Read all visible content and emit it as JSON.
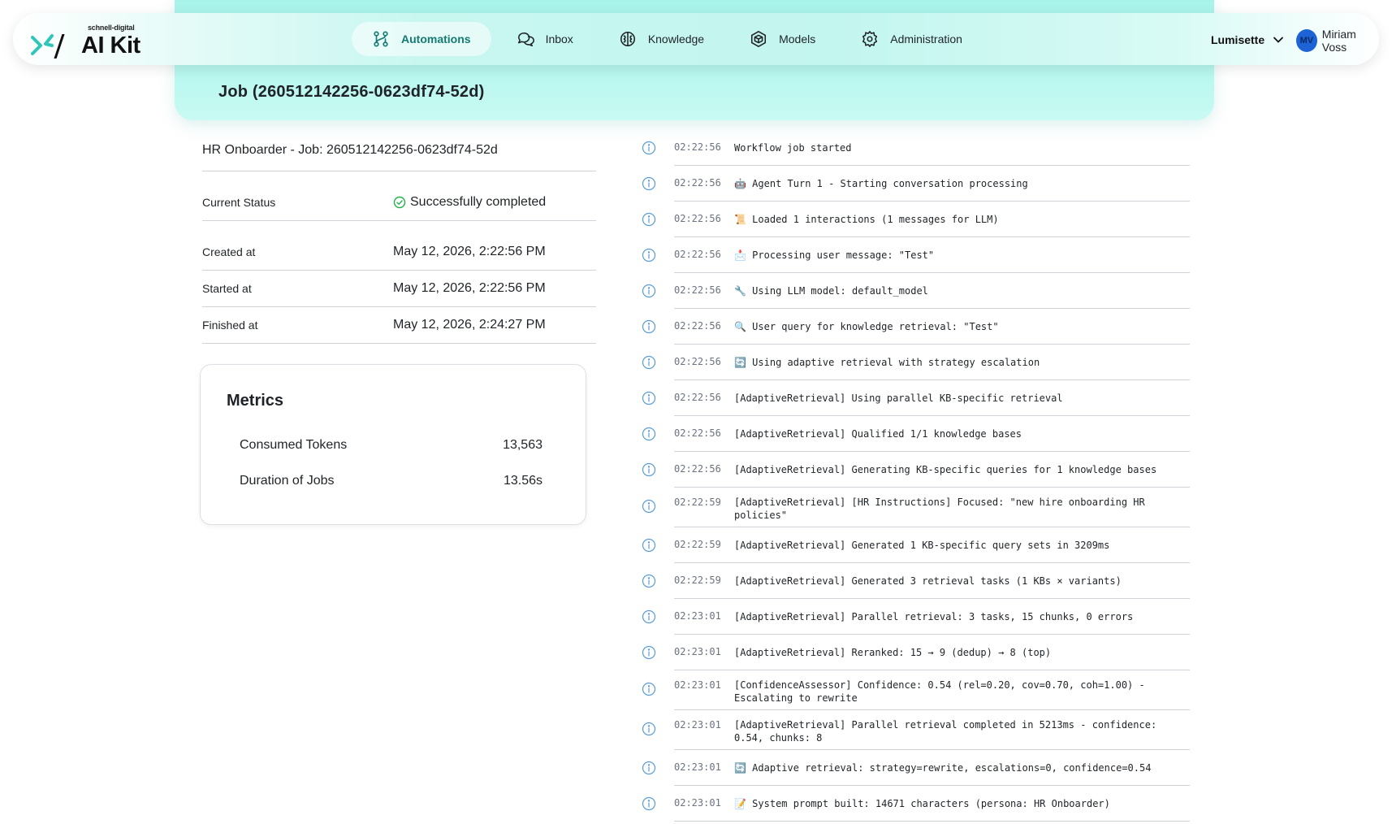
{
  "brand": {
    "small": "schnell-digital",
    "big": "AI Kit"
  },
  "nav": {
    "items": [
      {
        "label": "Automations",
        "icon": "workflow-icon",
        "active": true
      },
      {
        "label": "Inbox",
        "icon": "chat-icon"
      },
      {
        "label": "Knowledge",
        "icon": "brain-icon"
      },
      {
        "label": "Models",
        "icon": "cube-icon"
      },
      {
        "label": "Administration",
        "icon": "gear-icon"
      }
    ]
  },
  "org": {
    "name": "Lumisette"
  },
  "user": {
    "initials": "MV",
    "name": "Miriam Voss"
  },
  "job": {
    "title": "Job (260512142256-0623df74-52d)",
    "name": "HR Onboarder - Job: 260512142256-0623df74-52d",
    "details": [
      {
        "label": "Current Status",
        "value": "Successfully completed"
      },
      {
        "label": "Created at",
        "value": "May 12, 2026, 2:22:56 PM"
      },
      {
        "label": "Started at",
        "value": "May 12, 2026, 2:22:56 PM"
      },
      {
        "label": "Finished at",
        "value": "May 12, 2026, 2:24:27 PM"
      }
    ]
  },
  "metrics": {
    "title": "Metrics",
    "rows": [
      {
        "label": "Consumed Tokens",
        "value": "13,563"
      },
      {
        "label": "Duration of Jobs",
        "value": "13.56s"
      }
    ]
  },
  "log": [
    {
      "time": "02:22:56",
      "msg": "Workflow job started"
    },
    {
      "time": "02:22:56",
      "msg": "🤖 Agent Turn 1 - Starting conversation processing"
    },
    {
      "time": "02:22:56",
      "msg": "📜 Loaded 1 interactions (1 messages for LLM)"
    },
    {
      "time": "02:22:56",
      "msg": "📩 Processing user message: \"Test\""
    },
    {
      "time": "02:22:56",
      "msg": "🔧 Using LLM model: default_model"
    },
    {
      "time": "02:22:56",
      "msg": "🔍 User query for knowledge retrieval: \"Test\""
    },
    {
      "time": "02:22:56",
      "msg": "🔄 Using adaptive retrieval with strategy escalation"
    },
    {
      "time": "02:22:56",
      "msg": "[AdaptiveRetrieval] Using parallel KB-specific retrieval"
    },
    {
      "time": "02:22:56",
      "msg": "[AdaptiveRetrieval] Qualified 1/1 knowledge bases"
    },
    {
      "time": "02:22:56",
      "msg": "[AdaptiveRetrieval] Generating KB-specific queries for 1 knowledge bases"
    },
    {
      "time": "02:22:59",
      "msg": "[AdaptiveRetrieval] [HR Instructions] Focused: \"new hire onboarding HR policies\"",
      "wrap": true
    },
    {
      "time": "02:22:59",
      "msg": "[AdaptiveRetrieval] Generated 1 KB-specific query sets in 3209ms"
    },
    {
      "time": "02:22:59",
      "msg": "[AdaptiveRetrieval] Generated 3 retrieval tasks (1 KBs × variants)"
    },
    {
      "time": "02:23:01",
      "msg": "[AdaptiveRetrieval] Parallel retrieval: 3 tasks, 15 chunks, 0 errors"
    },
    {
      "time": "02:23:01",
      "msg": "[AdaptiveRetrieval] Reranked: 15 → 9 (dedup) → 8 (top)"
    },
    {
      "time": "02:23:01",
      "msg": "[ConfidenceAssessor] Confidence: 0.54 (rel=0.20, cov=0.70, coh=1.00) - Escalating to rewrite",
      "wrap": true
    },
    {
      "time": "02:23:01",
      "msg": "[AdaptiveRetrieval] Parallel retrieval completed in 5213ms - confidence: 0.54, chunks: 8",
      "wrap": true
    },
    {
      "time": "02:23:01",
      "msg": "🔄 Adaptive retrieval: strategy=rewrite, escalations=0, confidence=0.54"
    },
    {
      "time": "02:23:01",
      "msg": "📝 System prompt built: 14671 characters (persona: HR Onboarder)"
    }
  ]
}
